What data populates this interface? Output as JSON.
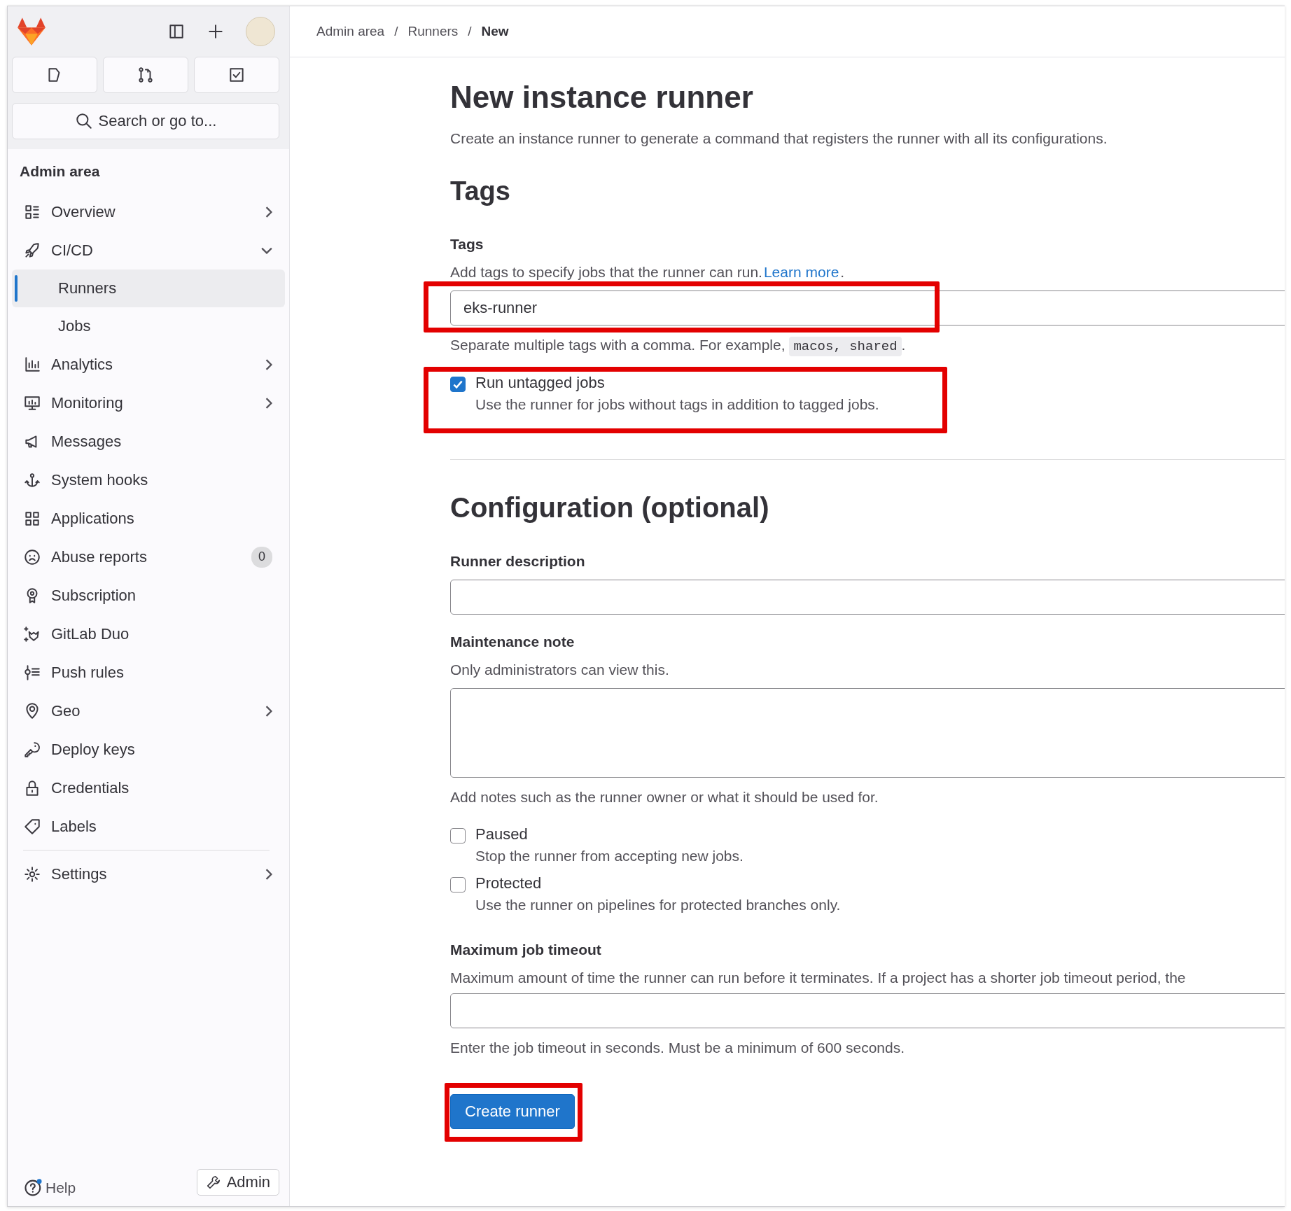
{
  "sidebar": {
    "search": "Search or go to...",
    "section_title": "Admin area",
    "items": [
      {
        "label": "Overview",
        "kind": "group",
        "expanded": false,
        "selected": false
      },
      {
        "label": "CI/CD",
        "kind": "group",
        "expanded": true,
        "selected": false,
        "children": [
          {
            "label": "Runners",
            "selected": true
          },
          {
            "label": "Jobs",
            "selected": false
          }
        ]
      },
      {
        "label": "Analytics",
        "kind": "group",
        "expanded": false,
        "selected": false
      },
      {
        "label": "Monitoring",
        "kind": "group",
        "expanded": false,
        "selected": false
      },
      {
        "label": "Messages",
        "kind": "link",
        "selected": false
      },
      {
        "label": "System hooks",
        "kind": "link",
        "selected": false
      },
      {
        "label": "Applications",
        "kind": "link",
        "selected": false
      },
      {
        "label": "Abuse reports",
        "kind": "link",
        "selected": false,
        "badge": "0"
      },
      {
        "label": "Subscription",
        "kind": "link",
        "selected": false
      },
      {
        "label": "GitLab Duo",
        "kind": "link",
        "selected": false
      },
      {
        "label": "Push rules",
        "kind": "link",
        "selected": false
      },
      {
        "label": "Geo",
        "kind": "group",
        "expanded": false,
        "selected": false
      },
      {
        "label": "Deploy keys",
        "kind": "link",
        "selected": false
      },
      {
        "label": "Credentials",
        "kind": "link",
        "selected": false
      },
      {
        "label": "Labels",
        "kind": "link",
        "selected": false
      }
    ],
    "bottom_items": [
      {
        "label": "Settings",
        "kind": "group",
        "expanded": false,
        "selected": false
      }
    ],
    "help": "Help",
    "admin_button": "Admin"
  },
  "breadcrumbs": [
    {
      "kind": "link",
      "text": "Admin area"
    },
    {
      "kind": "separator",
      "text": "/"
    },
    {
      "kind": "link",
      "text": "Runners"
    },
    {
      "kind": "separator",
      "text": "/"
    },
    {
      "kind": "current",
      "text": "New"
    }
  ],
  "page": {
    "title": "New instance runner",
    "description": "Create an instance runner to generate a command that registers the runner with all its configurations.",
    "tags_section": {
      "heading": "Tags",
      "field_label": "Tags",
      "help_before": "Add tags to specify jobs that the runner can run. ",
      "help_link": "Learn more",
      "help_after": ".",
      "value": "eks-runner",
      "hint_before": "Separate multiple tags with a comma. For example, ",
      "hint_code": "macos, shared",
      "hint_after": ".",
      "checkboxes": [
        {
          "label": "Run untagged jobs",
          "description": "Use the runner for jobs without tags in addition to tagged jobs.",
          "checked": true
        }
      ]
    },
    "config_section": {
      "heading": "Configuration (optional)",
      "description_label": "Runner description",
      "note_label": "Maintenance note",
      "note_help": "Only administrators can view this.",
      "note_hint": "Add notes such as the runner owner or what it should be used for.",
      "checkboxes": [
        {
          "label": "Paused",
          "description": "Stop the runner from accepting new jobs.",
          "checked": false
        },
        {
          "label": "Protected",
          "description": "Use the runner on pipelines for protected branches only.",
          "checked": false
        }
      ],
      "timeout_label": "Maximum job timeout",
      "timeout_help": "Maximum amount of time the runner can run before it terminates. If a project has a shorter job timeout period, the",
      "timeout_hint": "Enter the job timeout in seconds. Must be a minimum of 600 seconds."
    },
    "submit_button": "Create runner"
  }
}
